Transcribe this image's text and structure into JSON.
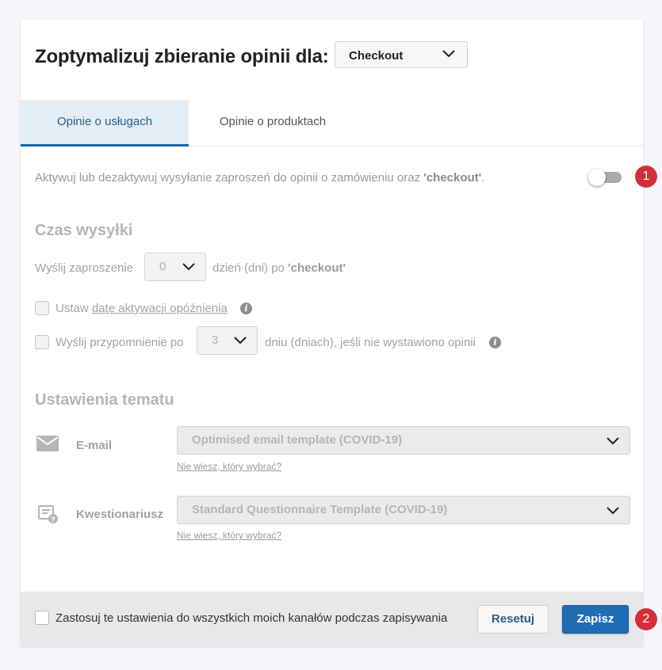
{
  "header": {
    "title": "Zoptymalizuj zbieranie opinii dla:",
    "channel_select": "Checkout"
  },
  "tabs": [
    {
      "label": "Opinie o usługach",
      "active": true
    },
    {
      "label": "Opinie o produktach",
      "active": false
    }
  ],
  "activation": {
    "text": "Aktywuj lub dezaktywuj wysyłanie zaproszeń do opinii o zamówieniu oraz ",
    "channel": "'checkout'",
    "suffix": ".",
    "toggle_on": false,
    "badge": "1"
  },
  "send_time": {
    "title": "Czas wysyłki",
    "invite_label": "Wyślij zaproszenie",
    "invite_days": "0",
    "invite_after": "dzień (dni) po ",
    "invite_channel": "'checkout'",
    "delay_prefix": "Ustaw ",
    "delay_link": "datę aktywacji opóźnienia",
    "reminder_label": "Wyślij przypomnienie po",
    "reminder_days": "3",
    "reminder_after": "dniu (dniach), jeśli nie wystawiono opinii",
    "info_glyph": "i"
  },
  "theme": {
    "title": "Ustawienia tematu",
    "email_label": "E-mail",
    "email_template": "Optimised email template (COVID-19)",
    "email_help": "Nie wiesz, który wybrać?",
    "questionnaire_label": "Kwestionariusz",
    "questionnaire_template": "Standard Questionnaire Template (COVID-19)",
    "questionnaire_help": "Nie wiesz, który wybrać?"
  },
  "footer": {
    "apply_all_label": "Zastosuj te ustawienia do wszystkich moich kanałów podczas zapisywania",
    "reset_label": "Resetuj",
    "save_label": "Zapisz",
    "badge": "2"
  },
  "colors": {
    "accent": "#1e6db5",
    "tab_active_bg": "#e4eef6",
    "badge": "#d32f3a"
  },
  "icons": [
    "chevron-down-icon",
    "info-icon",
    "envelope-icon",
    "questionnaire-icon"
  ]
}
